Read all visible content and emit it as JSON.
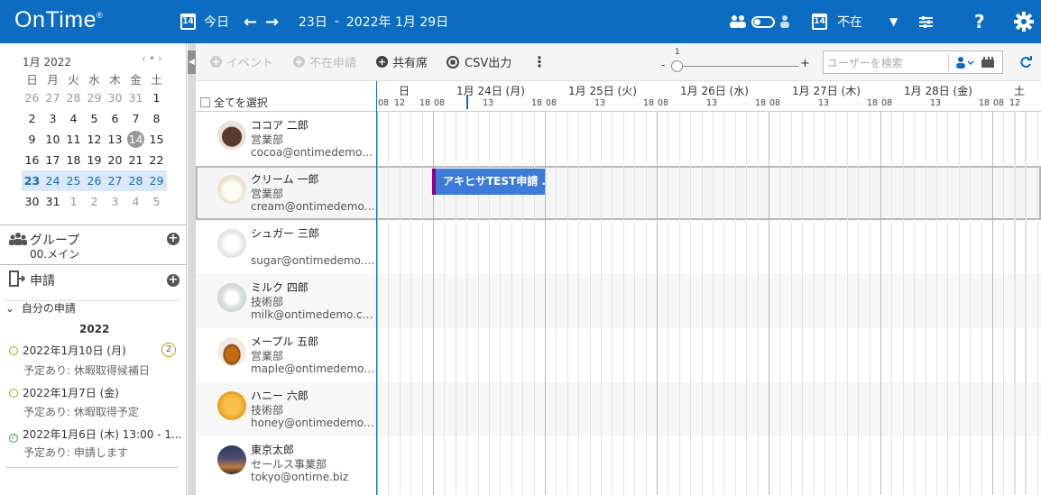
{
  "header": {
    "logo": "OnTime",
    "logo_mark": "®",
    "calendar_day": "14",
    "today_label": "今日",
    "date_range_start": "23日",
    "date_range_sep": "-",
    "date_range_end": "2022年 1月 29日",
    "absence_day": "14",
    "absence_label": "不在",
    "colors": {
      "bar": "#0b6cc1",
      "event": "#3e7ad8",
      "event_stripe": "#8b0080"
    }
  },
  "minical": {
    "month_label": "1月 2022",
    "nav_prev": "‹",
    "nav_dot": "•",
    "nav_next": "›",
    "weekdays": [
      "日",
      "月",
      "火",
      "水",
      "木",
      "金",
      "土"
    ],
    "weeks": [
      [
        "26",
        "27",
        "28",
        "29",
        "30",
        "31",
        "1"
      ],
      [
        "2",
        "3",
        "4",
        "5",
        "6",
        "7",
        "8"
      ],
      [
        "9",
        "10",
        "11",
        "12",
        "13",
        "14",
        "15"
      ],
      [
        "16",
        "17",
        "18",
        "19",
        "20",
        "21",
        "22"
      ],
      [
        "23",
        "24",
        "25",
        "26",
        "27",
        "28",
        "29"
      ],
      [
        "30",
        "31",
        "1",
        "2",
        "3",
        "4",
        "5"
      ]
    ]
  },
  "groups": {
    "title": "グループ",
    "value": "00.メイン"
  },
  "requests": {
    "title": "申請",
    "mine_label": "自分の申請",
    "mine_count": "2",
    "year": "2022",
    "items": [
      {
        "date": "2022年1月10日 (月)",
        "status": "予定あり: 休暇取得候補日"
      },
      {
        "date": "2022年1月7日 (金)",
        "status": "予定あり: 休暇取得予定"
      },
      {
        "date": "2022年1月6日 (木)  13:00 - 1...",
        "status": "予定あり: 申請します"
      }
    ]
  },
  "toolbar": {
    "event_label": "イベント",
    "absence_request_label": "不在申請",
    "shared_seat_label": "共有席",
    "csv_label": "CSV出力",
    "more_label": "⋮",
    "zoom_minus": "-",
    "zoom_value": "1",
    "zoom_plus": "+",
    "search_placeholder": "ユーザーを検索"
  },
  "grid": {
    "select_all": "全てを選択",
    "days": [
      "日",
      "1月 24日 (月)",
      "1月 25日 (火)",
      "1月 26日 (水)",
      "1月 27日 (木)",
      "1月 28日 (金)",
      "土"
    ],
    "hours": [
      "08",
      "12",
      "18",
      "08",
      "13",
      "18",
      "08",
      "13",
      "18",
      "08",
      "13",
      "18",
      "08",
      "13",
      "18",
      "08",
      "13",
      "18",
      "08",
      "12"
    ],
    "event": {
      "title": "アキヒサTEST申請 ..."
    },
    "people": [
      {
        "name": "ココア 二郎",
        "dept": "営業部",
        "email": "cocoa@ontimedemo.c..."
      },
      {
        "name": "クリーム 一郎",
        "dept": "営業部",
        "email": "cream@ontimedemo.c..."
      },
      {
        "name": "シュガー 三郎",
        "dept": "",
        "email": "sugar@ontimedemo.c..."
      },
      {
        "name": "ミルク 四郎",
        "dept": "技術部",
        "email": "milk@ontimedemo.com"
      },
      {
        "name": "メープル 五郎",
        "dept": "営業部",
        "email": "maple@ontimedemo.c..."
      },
      {
        "name": "ハニー 六郎",
        "dept": "技術部",
        "email": "honey@ontimedemo.c..."
      },
      {
        "name": "東京太郎",
        "dept": "セールス事業部",
        "email": "tokyo@ontime.biz"
      }
    ]
  }
}
